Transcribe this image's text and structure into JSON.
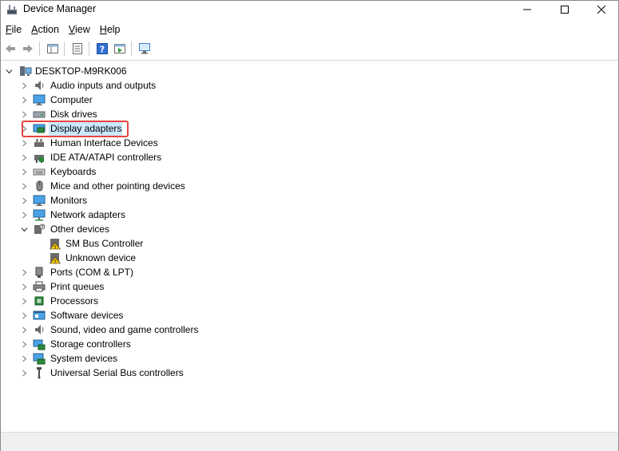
{
  "window": {
    "title": "Device Manager",
    "controls": {
      "minimize": "–",
      "maximize": "☐",
      "close": "✕"
    }
  },
  "menu": [
    {
      "key": "F",
      "rest": "ile"
    },
    {
      "key": "A",
      "rest": "ction"
    },
    {
      "key": "V",
      "rest": "iew"
    },
    {
      "key": "H",
      "rest": "elp"
    }
  ],
  "toolbar": [
    "back-icon",
    "forward-icon",
    "show-hide-console-tree-icon",
    "properties-icon",
    "help-icon",
    "update-driver-icon",
    "scan-hardware-icon"
  ],
  "tree": {
    "root": "DESKTOP-M9RK006",
    "categories": [
      {
        "label": "Audio inputs and outputs",
        "icon": "speaker-icon"
      },
      {
        "label": "Computer",
        "icon": "monitor-icon"
      },
      {
        "label": "Disk drives",
        "icon": "disk-drive-icon"
      },
      {
        "label": "Display adapters",
        "icon": "display-adapter-icon",
        "selected": true
      },
      {
        "label": "Human Interface Devices",
        "icon": "hid-icon"
      },
      {
        "label": "IDE ATA/ATAPI controllers",
        "icon": "ide-controller-icon"
      },
      {
        "label": "Keyboards",
        "icon": "keyboard-icon"
      },
      {
        "label": "Mice and other pointing devices",
        "icon": "mouse-icon"
      },
      {
        "label": "Monitors",
        "icon": "monitor-icon"
      },
      {
        "label": "Network adapters",
        "icon": "network-adapter-icon"
      },
      {
        "label": "Other devices",
        "icon": "other-devices-icon",
        "expanded": true,
        "children": [
          {
            "label": "SM Bus Controller",
            "icon": "warning-device-icon"
          },
          {
            "label": "Unknown device",
            "icon": "warning-device-icon"
          }
        ]
      },
      {
        "label": "Ports (COM & LPT)",
        "icon": "port-icon"
      },
      {
        "label": "Print queues",
        "icon": "printer-icon"
      },
      {
        "label": "Processors",
        "icon": "processor-icon"
      },
      {
        "label": "Software devices",
        "icon": "software-device-icon"
      },
      {
        "label": "Sound, video and game controllers",
        "icon": "speaker-icon"
      },
      {
        "label": "Storage controllers",
        "icon": "storage-controller-icon"
      },
      {
        "label": "System devices",
        "icon": "system-devices-icon"
      },
      {
        "label": "Universal Serial Bus controllers",
        "icon": "usb-icon"
      }
    ]
  },
  "colors": {
    "selection": "#cce8ff",
    "highlight_border": "#e8453c"
  }
}
